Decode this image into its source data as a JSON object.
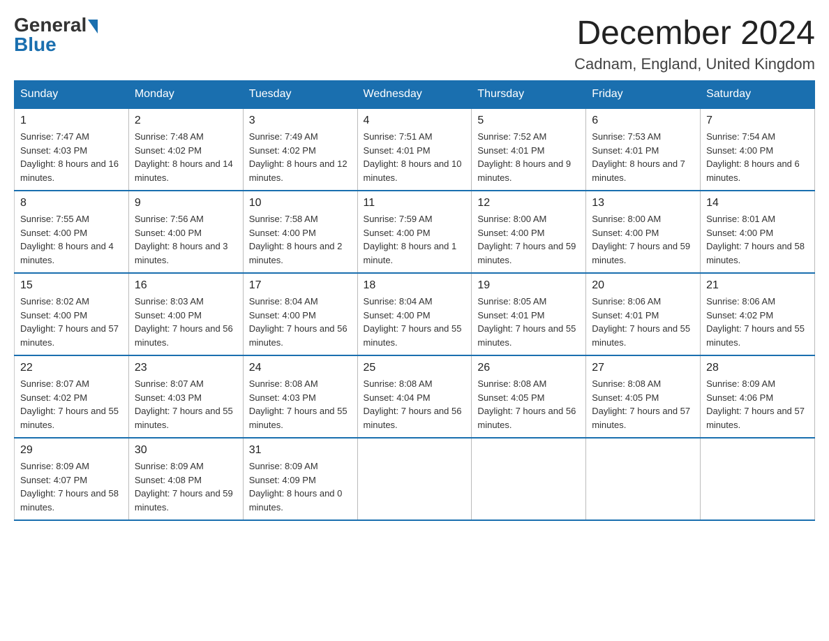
{
  "logo": {
    "general": "General",
    "blue": "Blue"
  },
  "title": "December 2024",
  "location": "Cadnam, England, United Kingdom",
  "days_of_week": [
    "Sunday",
    "Monday",
    "Tuesday",
    "Wednesday",
    "Thursday",
    "Friday",
    "Saturday"
  ],
  "weeks": [
    [
      {
        "day": 1,
        "sunrise": "7:47 AM",
        "sunset": "4:03 PM",
        "daylight": "8 hours and 16 minutes."
      },
      {
        "day": 2,
        "sunrise": "7:48 AM",
        "sunset": "4:02 PM",
        "daylight": "8 hours and 14 minutes."
      },
      {
        "day": 3,
        "sunrise": "7:49 AM",
        "sunset": "4:02 PM",
        "daylight": "8 hours and 12 minutes."
      },
      {
        "day": 4,
        "sunrise": "7:51 AM",
        "sunset": "4:01 PM",
        "daylight": "8 hours and 10 minutes."
      },
      {
        "day": 5,
        "sunrise": "7:52 AM",
        "sunset": "4:01 PM",
        "daylight": "8 hours and 9 minutes."
      },
      {
        "day": 6,
        "sunrise": "7:53 AM",
        "sunset": "4:01 PM",
        "daylight": "8 hours and 7 minutes."
      },
      {
        "day": 7,
        "sunrise": "7:54 AM",
        "sunset": "4:00 PM",
        "daylight": "8 hours and 6 minutes."
      }
    ],
    [
      {
        "day": 8,
        "sunrise": "7:55 AM",
        "sunset": "4:00 PM",
        "daylight": "8 hours and 4 minutes."
      },
      {
        "day": 9,
        "sunrise": "7:56 AM",
        "sunset": "4:00 PM",
        "daylight": "8 hours and 3 minutes."
      },
      {
        "day": 10,
        "sunrise": "7:58 AM",
        "sunset": "4:00 PM",
        "daylight": "8 hours and 2 minutes."
      },
      {
        "day": 11,
        "sunrise": "7:59 AM",
        "sunset": "4:00 PM",
        "daylight": "8 hours and 1 minute."
      },
      {
        "day": 12,
        "sunrise": "8:00 AM",
        "sunset": "4:00 PM",
        "daylight": "7 hours and 59 minutes."
      },
      {
        "day": 13,
        "sunrise": "8:00 AM",
        "sunset": "4:00 PM",
        "daylight": "7 hours and 59 minutes."
      },
      {
        "day": 14,
        "sunrise": "8:01 AM",
        "sunset": "4:00 PM",
        "daylight": "7 hours and 58 minutes."
      }
    ],
    [
      {
        "day": 15,
        "sunrise": "8:02 AM",
        "sunset": "4:00 PM",
        "daylight": "7 hours and 57 minutes."
      },
      {
        "day": 16,
        "sunrise": "8:03 AM",
        "sunset": "4:00 PM",
        "daylight": "7 hours and 56 minutes."
      },
      {
        "day": 17,
        "sunrise": "8:04 AM",
        "sunset": "4:00 PM",
        "daylight": "7 hours and 56 minutes."
      },
      {
        "day": 18,
        "sunrise": "8:04 AM",
        "sunset": "4:00 PM",
        "daylight": "7 hours and 55 minutes."
      },
      {
        "day": 19,
        "sunrise": "8:05 AM",
        "sunset": "4:01 PM",
        "daylight": "7 hours and 55 minutes."
      },
      {
        "day": 20,
        "sunrise": "8:06 AM",
        "sunset": "4:01 PM",
        "daylight": "7 hours and 55 minutes."
      },
      {
        "day": 21,
        "sunrise": "8:06 AM",
        "sunset": "4:02 PM",
        "daylight": "7 hours and 55 minutes."
      }
    ],
    [
      {
        "day": 22,
        "sunrise": "8:07 AM",
        "sunset": "4:02 PM",
        "daylight": "7 hours and 55 minutes."
      },
      {
        "day": 23,
        "sunrise": "8:07 AM",
        "sunset": "4:03 PM",
        "daylight": "7 hours and 55 minutes."
      },
      {
        "day": 24,
        "sunrise": "8:08 AM",
        "sunset": "4:03 PM",
        "daylight": "7 hours and 55 minutes."
      },
      {
        "day": 25,
        "sunrise": "8:08 AM",
        "sunset": "4:04 PM",
        "daylight": "7 hours and 56 minutes."
      },
      {
        "day": 26,
        "sunrise": "8:08 AM",
        "sunset": "4:05 PM",
        "daylight": "7 hours and 56 minutes."
      },
      {
        "day": 27,
        "sunrise": "8:08 AM",
        "sunset": "4:05 PM",
        "daylight": "7 hours and 57 minutes."
      },
      {
        "day": 28,
        "sunrise": "8:09 AM",
        "sunset": "4:06 PM",
        "daylight": "7 hours and 57 minutes."
      }
    ],
    [
      {
        "day": 29,
        "sunrise": "8:09 AM",
        "sunset": "4:07 PM",
        "daylight": "7 hours and 58 minutes."
      },
      {
        "day": 30,
        "sunrise": "8:09 AM",
        "sunset": "4:08 PM",
        "daylight": "7 hours and 59 minutes."
      },
      {
        "day": 31,
        "sunrise": "8:09 AM",
        "sunset": "4:09 PM",
        "daylight": "8 hours and 0 minutes."
      },
      null,
      null,
      null,
      null
    ]
  ],
  "sunrise_label": "Sunrise:",
  "sunset_label": "Sunset:",
  "daylight_label": "Daylight:"
}
